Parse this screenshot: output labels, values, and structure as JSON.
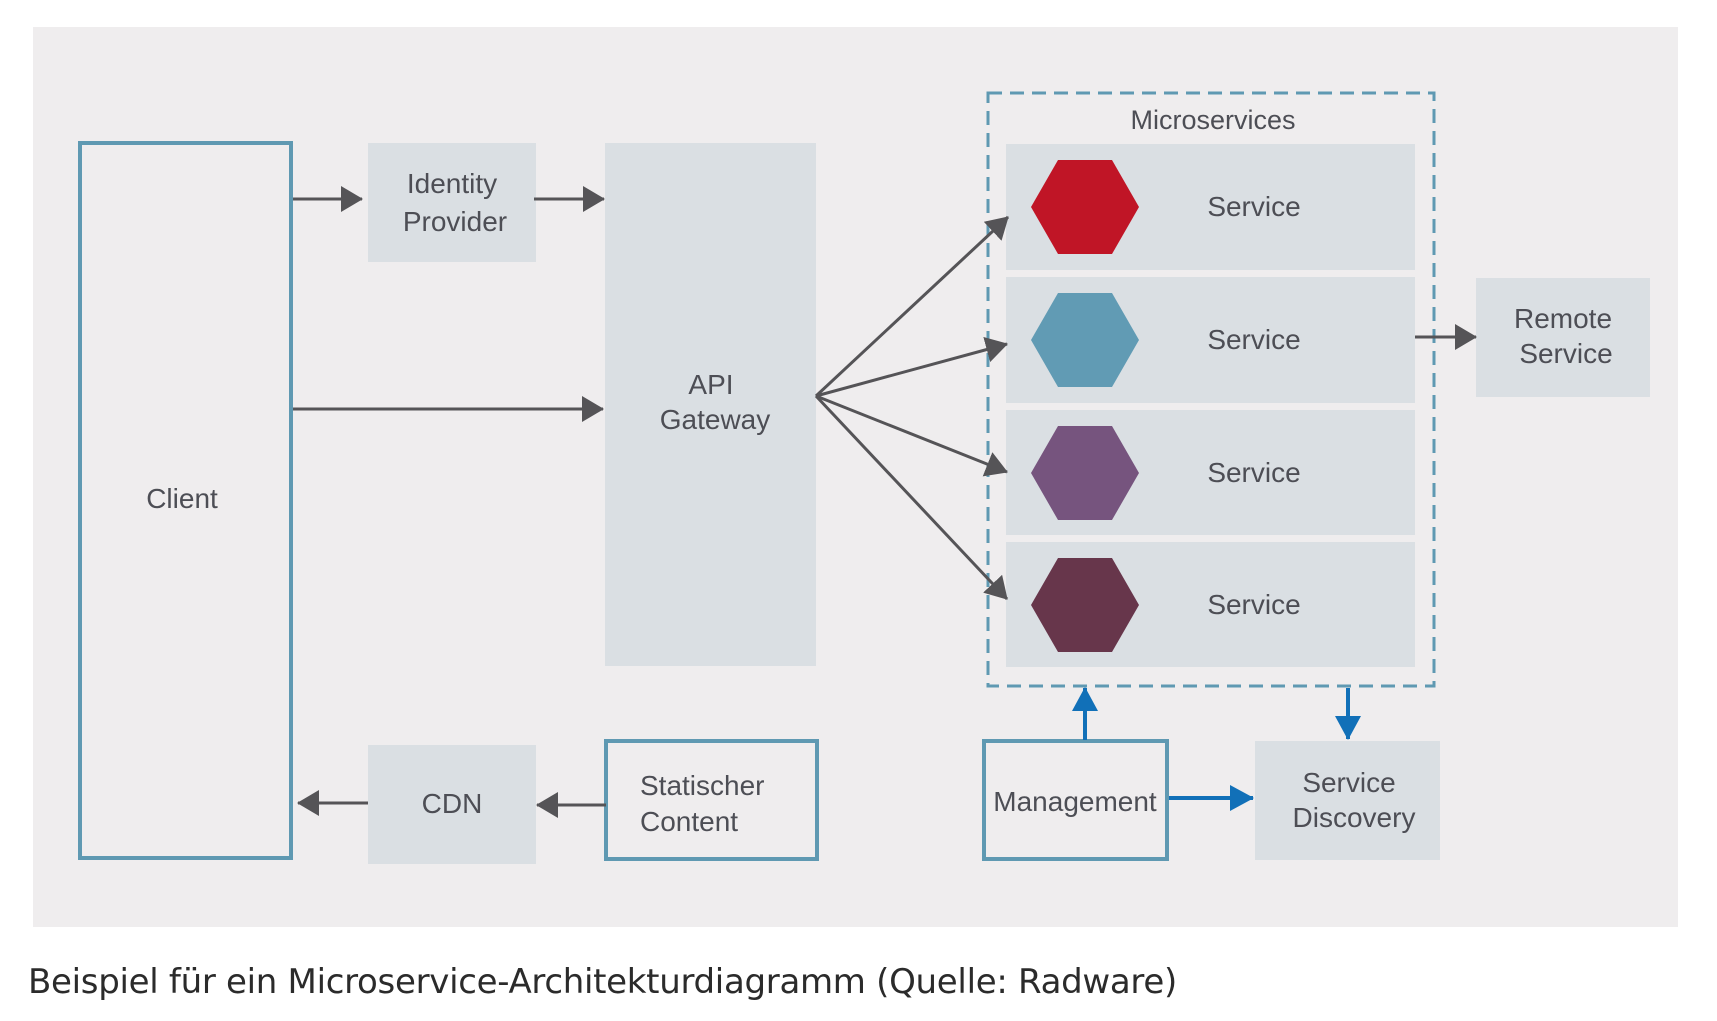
{
  "diagram": {
    "type": "microservice-architecture",
    "colors": {
      "panel_bg": "#efedee",
      "box_fill": "#dadfe3",
      "outline_blue": "#5f99b2",
      "arrow_dark": "#555457",
      "arrow_blue": "#1170b8",
      "text": "#4d4e55"
    },
    "nodes": {
      "client": {
        "label": "Client"
      },
      "identity_provider": {
        "line1": "Identity",
        "line2": "Provider"
      },
      "api_gateway": {
        "line1": "API",
        "line2": "Gateway"
      },
      "microservices_group": {
        "label": "Microservices"
      },
      "services": [
        {
          "label": "Service",
          "hex_color": "#c01526"
        },
        {
          "label": "Service",
          "hex_color": "#619bb4"
        },
        {
          "label": "Service",
          "hex_color": "#76547e"
        },
        {
          "label": "Service",
          "hex_color": "#67364b"
        }
      ],
      "remote_service": {
        "line1": "Remote",
        "line2": "Service"
      },
      "cdn": {
        "label": "CDN"
      },
      "static_content": {
        "line1": "Statischer",
        "line2": "Content"
      },
      "management": {
        "label": "Management"
      },
      "service_discovery": {
        "line1": "Service",
        "line2": "Discovery"
      }
    },
    "edges": [
      {
        "from": "Client",
        "to": "Identity Provider"
      },
      {
        "from": "Identity Provider",
        "to": "API Gateway"
      },
      {
        "from": "Client",
        "to": "API Gateway"
      },
      {
        "from": "API Gateway",
        "to": "Service 1"
      },
      {
        "from": "API Gateway",
        "to": "Service 2"
      },
      {
        "from": "API Gateway",
        "to": "Service 3"
      },
      {
        "from": "API Gateway",
        "to": "Service 4"
      },
      {
        "from": "Service 2",
        "to": "Remote Service"
      },
      {
        "from": "Statischer Content",
        "to": "CDN"
      },
      {
        "from": "CDN",
        "to": "Client"
      },
      {
        "from": "Management",
        "to": "Microservices"
      },
      {
        "from": "Microservices",
        "to": "Service Discovery"
      },
      {
        "from": "Management",
        "to": "Service Discovery"
      }
    ]
  },
  "caption": "Beispiel für ein Microservice-Architekturdiagramm (Quelle: Radware)"
}
